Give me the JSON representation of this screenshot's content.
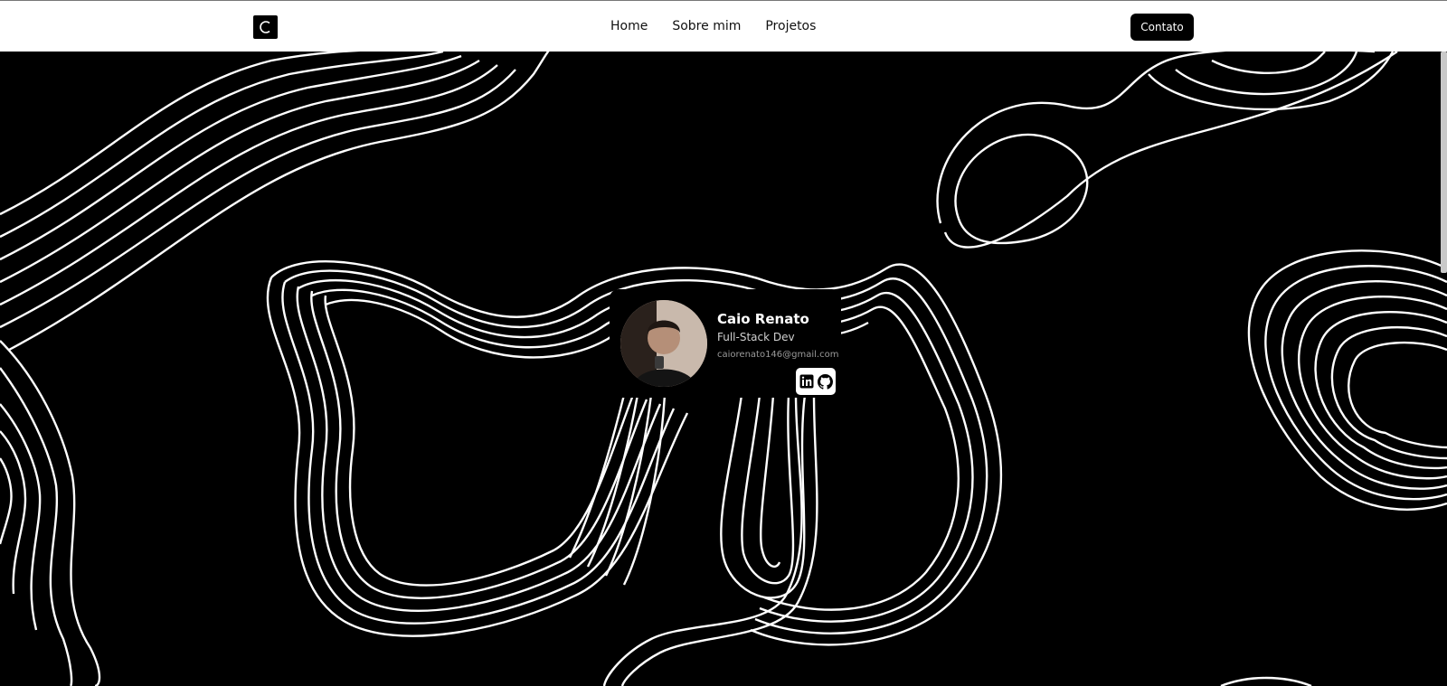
{
  "header": {
    "logo_letter": "C",
    "nav": [
      "Home",
      "Sobre mim",
      "Projetos"
    ],
    "contact_label": "Contato"
  },
  "profile": {
    "name": "Caio Renato",
    "role": "Full-Stack Dev",
    "email": "caiorenato146@gmail.com"
  },
  "icons": {
    "linkedin": "linkedin-icon",
    "github": "github-icon"
  },
  "colors": {
    "background": "#000000",
    "navbar": "#ffffff",
    "accent": "#000000",
    "lines": "#ffffff"
  }
}
